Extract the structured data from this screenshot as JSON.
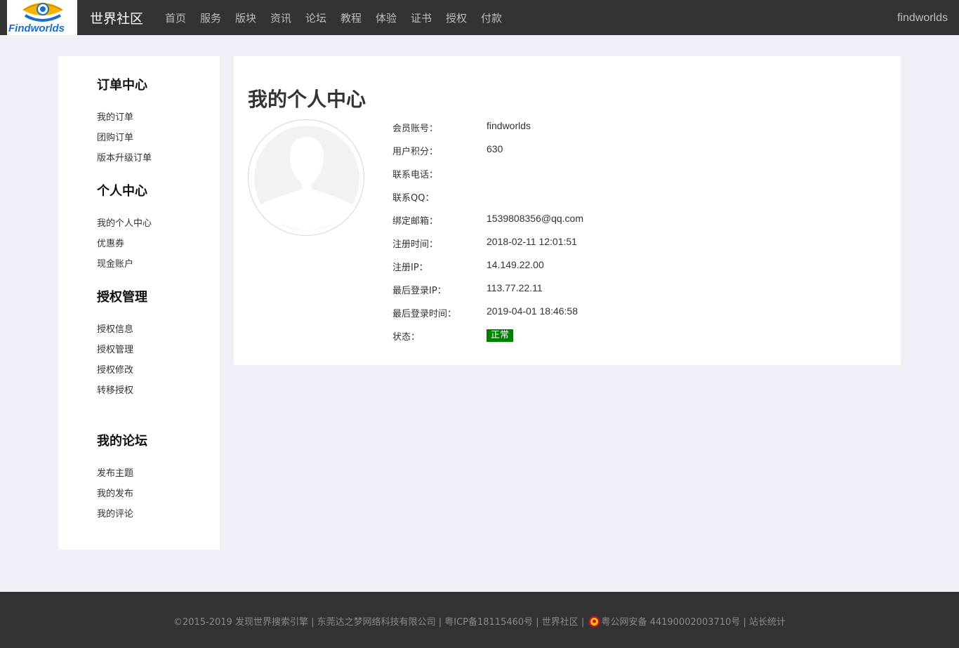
{
  "header": {
    "logo_text": "Findworlds",
    "brand": "世界社区",
    "nav": [
      "首页",
      "服务",
      "版块",
      "资讯",
      "论坛",
      "教程",
      "体验",
      "证书",
      "授权",
      "付款"
    ],
    "username": "findworlds"
  },
  "sidebar": {
    "sections": [
      {
        "heading": "订单中心",
        "items": [
          "我的订单",
          "团购订单",
          "版本升级订单"
        ]
      },
      {
        "heading": "个人中心",
        "items": [
          "我的个人中心",
          "优惠券",
          "现金账户"
        ]
      },
      {
        "heading": "授权管理",
        "items": [
          "授权信息",
          "授权管理",
          "授权修改",
          "转移授权"
        ]
      },
      {
        "heading": "我的论坛",
        "items": [
          "发布主题",
          "我的发布",
          "我的评论"
        ]
      }
    ]
  },
  "main": {
    "title": "我的个人中心",
    "fields": [
      {
        "label": "会员账号：",
        "value": "findworlds"
      },
      {
        "label": "用户积分：",
        "value": "630"
      },
      {
        "label": "联系电话：",
        "value": ""
      },
      {
        "label": "联系QQ：",
        "value": ""
      },
      {
        "label": "绑定邮箱：",
        "value": "1539808356@qq.com"
      },
      {
        "label": "注册时间：",
        "value": "2018-02-11 12:01:51"
      },
      {
        "label": "注册IP：",
        "value": "14.149.22.00"
      },
      {
        "label": "最后登录IP：",
        "value": "113.77.22.11"
      },
      {
        "label": "最后登录时间：",
        "value": "2019-04-01 18:46:58"
      }
    ],
    "status_label": "状态：",
    "status_value": "正常",
    "status_color": "#008000"
  },
  "footer": {
    "part1": "©2015-2019 发现世界搜索引擎 | 东莞达之梦网络科技有限公司 | 粤ICP备18115460号 | 世界社区 |",
    "part2": "粤公网安备 44190002003710号 | 站长统计"
  },
  "icons": {
    "logo": "eye-logo-icon",
    "avatar": "user-silhouette-icon",
    "police": "police-badge-icon"
  }
}
